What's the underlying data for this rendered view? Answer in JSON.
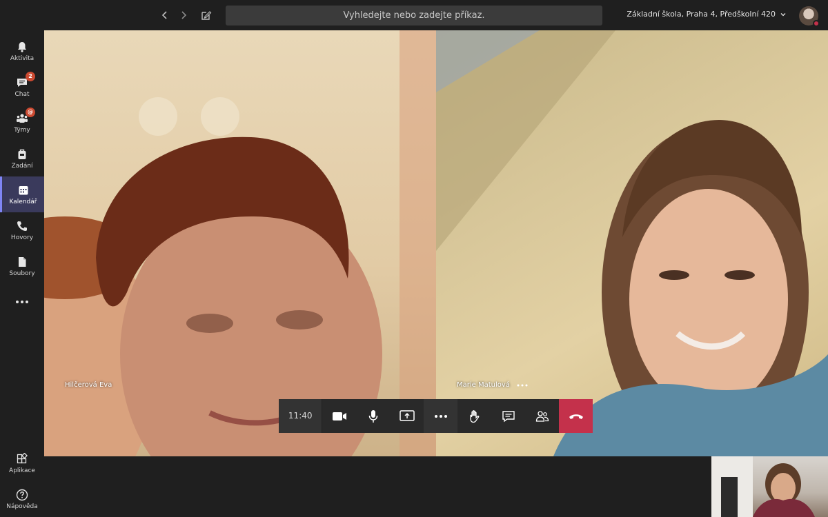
{
  "topbar": {
    "back_icon": "chevron-left-icon",
    "forward_icon": "chevron-right-icon",
    "compose_icon": "compose-icon",
    "search_placeholder": "Vyhledejte nebo zadejte příkaz.",
    "org_name": "Základní škola, Praha 4, Předškolní 420"
  },
  "rail": {
    "items": [
      {
        "label": "Aktivita",
        "icon": "bell-icon"
      },
      {
        "label": "Chat",
        "icon": "chat-icon",
        "badge": "2"
      },
      {
        "label": "Týmy",
        "icon": "teams-icon",
        "badge": "@"
      },
      {
        "label": "Zadání",
        "icon": "assignments-icon"
      },
      {
        "label": "Kalendář",
        "icon": "calendar-icon"
      },
      {
        "label": "Hovory",
        "icon": "phone-icon"
      },
      {
        "label": "Soubory",
        "icon": "files-icon"
      },
      {
        "label": "Aplikace",
        "icon": "apps-icon"
      },
      {
        "label": "Nápověda",
        "icon": "help-icon"
      }
    ],
    "more_icon": "more-icon"
  },
  "call": {
    "participants": [
      {
        "name": "Hilčerová Eva"
      },
      {
        "name": "Marie Matulová"
      }
    ],
    "duration": "11:40"
  },
  "colors": {
    "accent": "#7f85f5",
    "hangup": "#c4314b",
    "badge": "#cc4a31"
  }
}
